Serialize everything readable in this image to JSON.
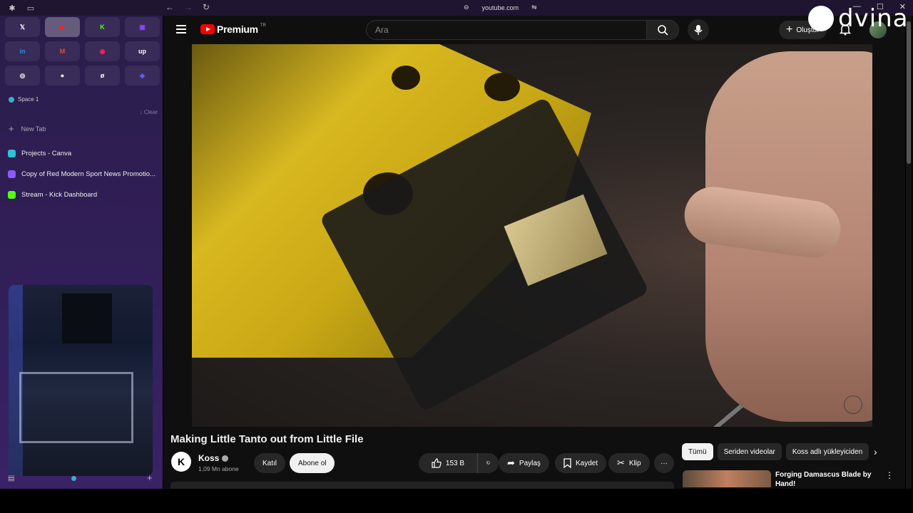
{
  "browser": {
    "url": "youtube.com",
    "nav": {
      "back": "←",
      "forward": "→",
      "reload": "↻"
    },
    "window_controls": [
      "—",
      "☐",
      "✕"
    ]
  },
  "sidebar": {
    "pinned": [
      {
        "icon": "x-icon",
        "glyph": "𝕏",
        "color": "#ffffff"
      },
      {
        "icon": "youtube-icon",
        "glyph": "▶",
        "color": "#ff2020",
        "active": true
      },
      {
        "icon": "kick-icon",
        "glyph": "K",
        "color": "#53fc18"
      },
      {
        "icon": "twitch-icon",
        "glyph": "▣",
        "color": "#9146ff"
      },
      {
        "icon": "linkedin-icon",
        "glyph": "in",
        "color": "#2f8cd8"
      },
      {
        "icon": "gmail-icon",
        "glyph": "M",
        "color": "#ea4335"
      },
      {
        "icon": "music-icon",
        "glyph": "◉",
        "color": "#ff2060"
      },
      {
        "icon": "upwork-icon",
        "glyph": "up",
        "color": "#ffffff"
      },
      {
        "icon": "globe-icon",
        "glyph": "◍",
        "color": "#cccccc"
      },
      {
        "icon": "dot-icon",
        "glyph": "●",
        "color": "#ffffff"
      },
      {
        "icon": "app-icon",
        "glyph": "ø",
        "color": "#ffffff"
      },
      {
        "icon": "discord-icon",
        "glyph": "◆",
        "color": "#5865f2"
      }
    ],
    "space_label": "Space 1",
    "clear_label": "Clear",
    "new_tab_label": "New Tab",
    "tabs": [
      {
        "label": "Projects - Canva",
        "color": "#2ec4d6"
      },
      {
        "label": "Copy of Red Modern Sport News Promotio...",
        "color": "#8a5cf6"
      },
      {
        "label": "Stream - Kick Dashboard",
        "color": "#53fc18"
      }
    ]
  },
  "youtube": {
    "logo_text": "Premium",
    "logo_region": "TR",
    "search_placeholder": "Ara",
    "create_label": "Oluştur",
    "watermark_text": "dvina",
    "video_title": "Making Little Tanto out from Little File",
    "channel": {
      "name": "Koss",
      "initial": "K",
      "subscribers": "1,09 Mn abone"
    },
    "join_label": "Katıl",
    "subscribe_label": "Abone ol",
    "likes": "153 B",
    "share_label": "Paylaş",
    "save_label": "Kaydet",
    "clip_label": "Klip",
    "more_label": "···",
    "chips": [
      "Tümü",
      "Seriden videolar",
      "Koss adlı yükleyiciden"
    ],
    "recommendation_title": "Forging Damascus Blade by Hand!"
  }
}
